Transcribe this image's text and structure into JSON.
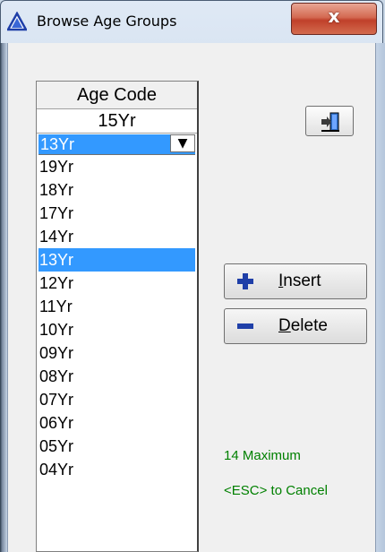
{
  "window": {
    "title": "Browse Age Groups",
    "close_glyph": "x",
    "icon": "triangle-app-icon",
    "accent": "#3399ff"
  },
  "grid": {
    "header": "Age Code",
    "value": "15Yr",
    "combo_value": "13Yr",
    "items": [
      {
        "label": "19Yr",
        "selected": false
      },
      {
        "label": "18Yr",
        "selected": false
      },
      {
        "label": "17Yr",
        "selected": false
      },
      {
        "label": "14Yr",
        "selected": false
      },
      {
        "label": "13Yr",
        "selected": true
      },
      {
        "label": "12Yr",
        "selected": false
      },
      {
        "label": "11Yr",
        "selected": false
      },
      {
        "label": "10Yr",
        "selected": false
      },
      {
        "label": "09Yr",
        "selected": false
      },
      {
        "label": "08Yr",
        "selected": false
      },
      {
        "label": "07Yr",
        "selected": false
      },
      {
        "label": "06Yr",
        "selected": false
      },
      {
        "label": "05Yr",
        "selected": false
      },
      {
        "label": "04Yr",
        "selected": false
      }
    ]
  },
  "buttons": {
    "exit_icon": "exit-door-icon",
    "insert_prefix": "I",
    "insert_rest": "nsert",
    "delete_prefix": "D",
    "delete_rest": "elete"
  },
  "info": {
    "maximum": "14 Maximum",
    "cancel": "<ESC> to Cancel"
  }
}
